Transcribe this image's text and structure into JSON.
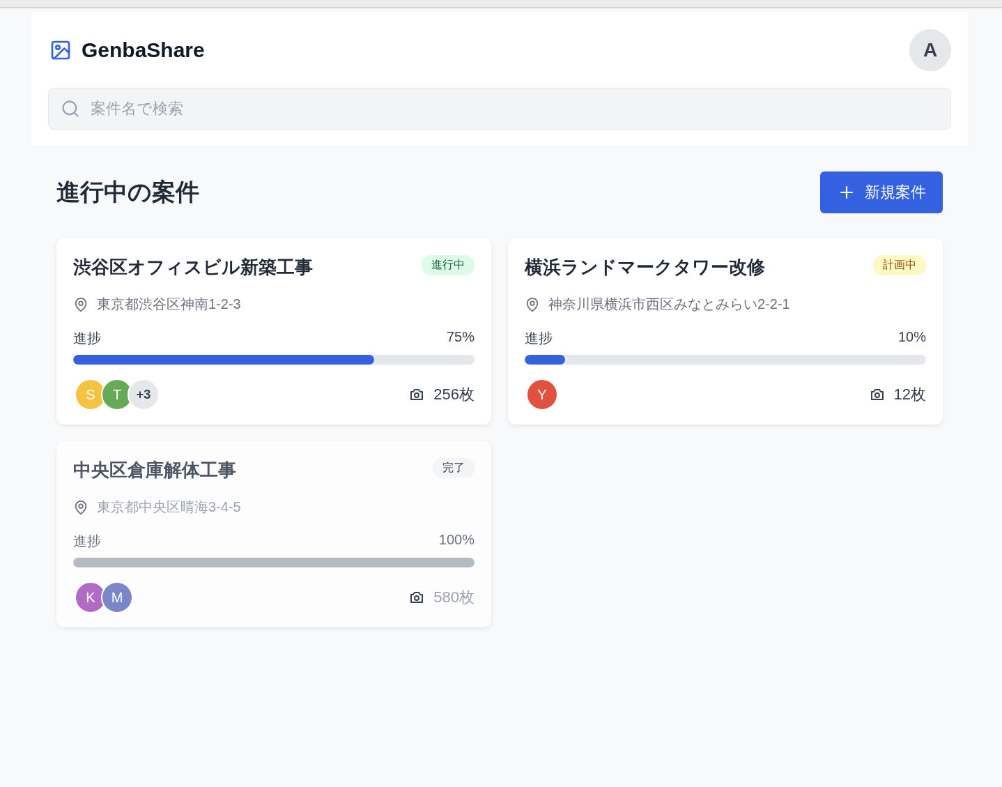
{
  "header": {
    "app_name": "GenbaShare",
    "user_initial": "A",
    "search": {
      "placeholder": "案件名で検索"
    }
  },
  "section": {
    "title": "進行中の案件",
    "new_button": "新規案件"
  },
  "projects": [
    {
      "name": "渋谷区オフィスビル新築工事",
      "status": {
        "kind": "in_progress",
        "label": "進行中"
      },
      "address": "東京都渋谷区神南1-2-3",
      "progress_label": "進捗",
      "progress_text": "75%",
      "level": 0.75,
      "members": [
        {
          "initial": "S",
          "color": "#f5c242"
        },
        {
          "initial": "T",
          "color": "#66aa55"
        }
      ],
      "more_members": "+3",
      "photos": "256枚"
    },
    {
      "name": "横浜ランドマークタワー改修",
      "status": {
        "kind": "planned",
        "label": "計画中"
      },
      "address": "神奈川県横浜市西区みなとみらい2-2-1",
      "progress_label": "進捗",
      "progress_text": "10%",
      "level": 0.1,
      "members": [
        {
          "initial": "Y",
          "color": "#e0523f"
        }
      ],
      "photos": "12枚"
    },
    {
      "name": "中央区倉庫解体工事",
      "status": {
        "kind": "done",
        "label": "完了"
      },
      "address": "東京都中央区晴海3-4-5",
      "progress_label": "進捗",
      "progress_text": "100%",
      "level": 1,
      "members": [
        {
          "initial": "K",
          "color": "#b06cc4"
        },
        {
          "initial": "M",
          "color": "#7a86c8"
        }
      ],
      "photos": "580枚"
    }
  ]
}
